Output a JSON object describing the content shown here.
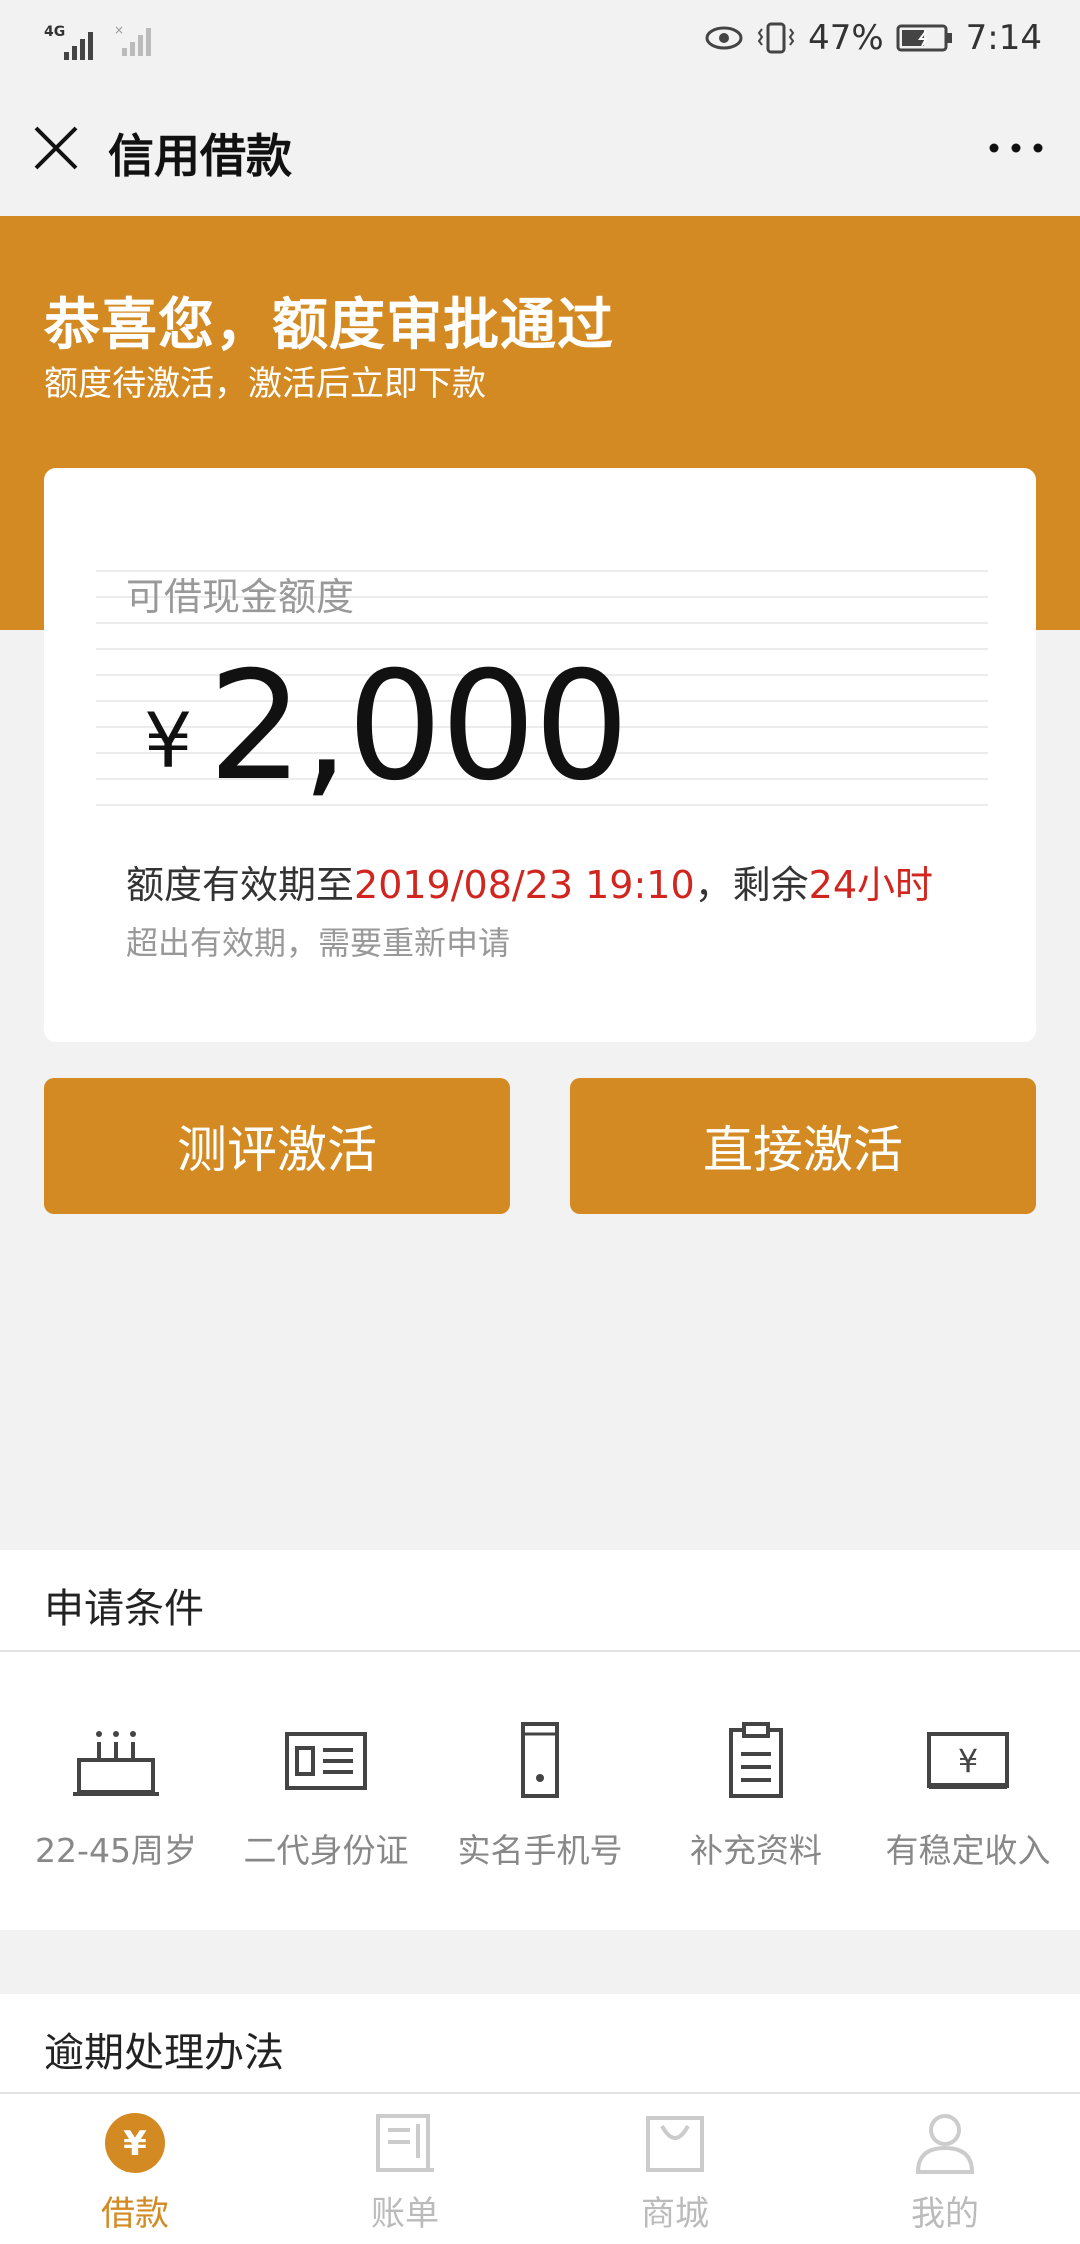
{
  "status_bar": {
    "network": "4G",
    "battery": "47%",
    "time": "7:14"
  },
  "header": {
    "title": "信用借款"
  },
  "banner": {
    "headline": "恭喜您，额度审批通过",
    "subtext": "额度待激活，激活后立即下款"
  },
  "card": {
    "label": "可借现金额度",
    "currency": "¥",
    "amount": "2,000",
    "valid_prefix": "额度有效期至",
    "valid_date": "2019/08/23 19:10",
    "valid_mid": "，剩余",
    "remaining": "24小时",
    "note": "超出有效期，需要重新申请"
  },
  "buttons": {
    "evaluate": "测评激活",
    "direct": "直接激活"
  },
  "conditions": {
    "title": "申请条件",
    "items": [
      {
        "label": "22-45周岁",
        "icon": "cake-icon"
      },
      {
        "label": "二代身份证",
        "icon": "id-card-icon"
      },
      {
        "label": "实名手机号",
        "icon": "phone-icon"
      },
      {
        "label": "补充资料",
        "icon": "clipboard-icon"
      },
      {
        "label": "有稳定收入",
        "icon": "income-icon"
      }
    ]
  },
  "overdue": {
    "title": "逾期处理办法"
  },
  "tabbar": {
    "items": [
      {
        "label": "借款",
        "icon": "loan-icon",
        "active": true
      },
      {
        "label": "账单",
        "icon": "bill-icon",
        "active": false
      },
      {
        "label": "商城",
        "icon": "shop-icon",
        "active": false
      },
      {
        "label": "我的",
        "icon": "profile-icon",
        "active": false
      }
    ]
  },
  "colors": {
    "accent": "#d38a22",
    "highlight_red": "#d1261f"
  }
}
